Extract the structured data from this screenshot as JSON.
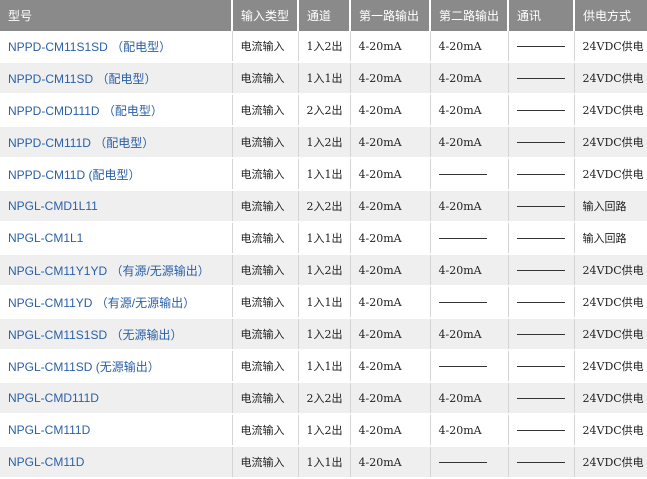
{
  "table": {
    "headers": [
      "型号",
      "输入类型",
      "通道",
      "第一路输出",
      "第二路输出",
      "通讯",
      "供电方式"
    ],
    "rows": [
      {
        "model": "NPPD-CM11S1SD （配电型）",
        "input": "电流输入",
        "channel": "1入2出",
        "out1": "4-20mA",
        "out2": "4-20mA",
        "comm": "————",
        "power": "24VDC供电"
      },
      {
        "model": "NPPD-CM11SD （配电型）",
        "input": "电流输入",
        "channel": "1入1出",
        "out1": "4-20mA",
        "out2": "4-20mA",
        "comm": "————",
        "power": "24VDC供电"
      },
      {
        "model": "NPPD-CMD111D （配电型）",
        "input": "电流输入",
        "channel": "2入2出",
        "out1": "4-20mA",
        "out2": "4-20mA",
        "comm": "————",
        "power": "24VDC供电"
      },
      {
        "model": "NPPD-CM111D （配电型）",
        "input": "电流输入",
        "channel": "1入2出",
        "out1": "4-20mA",
        "out2": "4-20mA",
        "comm": "————",
        "power": "24VDC供电"
      },
      {
        "model": "NPPD-CM11D (配电型）",
        "input": "电流输入",
        "channel": "1入1出",
        "out1": "4-20mA",
        "out2": "————",
        "comm": "————",
        "power": "24VDC供电"
      },
      {
        "model": "NPGL-CMD1L11",
        "input": "电流输入",
        "channel": "2入2出",
        "out1": "4-20mA",
        "out2": "4-20mA",
        "comm": "————",
        "power": "输入回路"
      },
      {
        "model": "NPGL-CM1L1",
        "input": "电流输入",
        "channel": "1入1出",
        "out1": "4-20mA",
        "out2": "————",
        "comm": "————",
        "power": "输入回路"
      },
      {
        "model": "NPGL-CM11Y1YD （有源/无源输出）",
        "input": "电流输入",
        "channel": "1入2出",
        "out1": "4-20mA",
        "out2": "4-20mA",
        "comm": "————",
        "power": "24VDC供电"
      },
      {
        "model": "NPGL-CM11YD （有源/无源输出）",
        "input": "电流输入",
        "channel": "1入1出",
        "out1": "4-20mA",
        "out2": "————",
        "comm": "————",
        "power": "24VDC供电"
      },
      {
        "model": "NPGL-CM11S1SD （无源输出）",
        "input": "电流输入",
        "channel": "1入2出",
        "out1": "4-20mA",
        "out2": "4-20mA",
        "comm": "————",
        "power": "24VDC供电"
      },
      {
        "model": "NPGL-CM11SD (无源输出）",
        "input": "电流输入",
        "channel": "1入1出",
        "out1": "4-20mA",
        "out2": "————",
        "comm": "————",
        "power": "24VDC供电"
      },
      {
        "model": "NPGL-CMD111D",
        "input": "电流输入",
        "channel": "2入2出",
        "out1": "4-20mA",
        "out2": "4-20mA",
        "comm": "————",
        "power": "24VDC供电"
      },
      {
        "model": "NPGL-CM111D",
        "input": "电流输入",
        "channel": "1入2出",
        "out1": "4-20mA",
        "out2": "4-20mA",
        "comm": "————",
        "power": "24VDC供电"
      },
      {
        "model": "NPGL-CM11D",
        "input": "电流输入",
        "channel": "1入1出",
        "out1": "4-20mA",
        "out2": "————",
        "comm": "————",
        "power": "24VDC供电"
      }
    ]
  },
  "colors": {
    "header_bg": "#8a8a8a",
    "header_text": "#ffffff",
    "link": "#2a5fa8",
    "row_alt": "#efefef"
  }
}
